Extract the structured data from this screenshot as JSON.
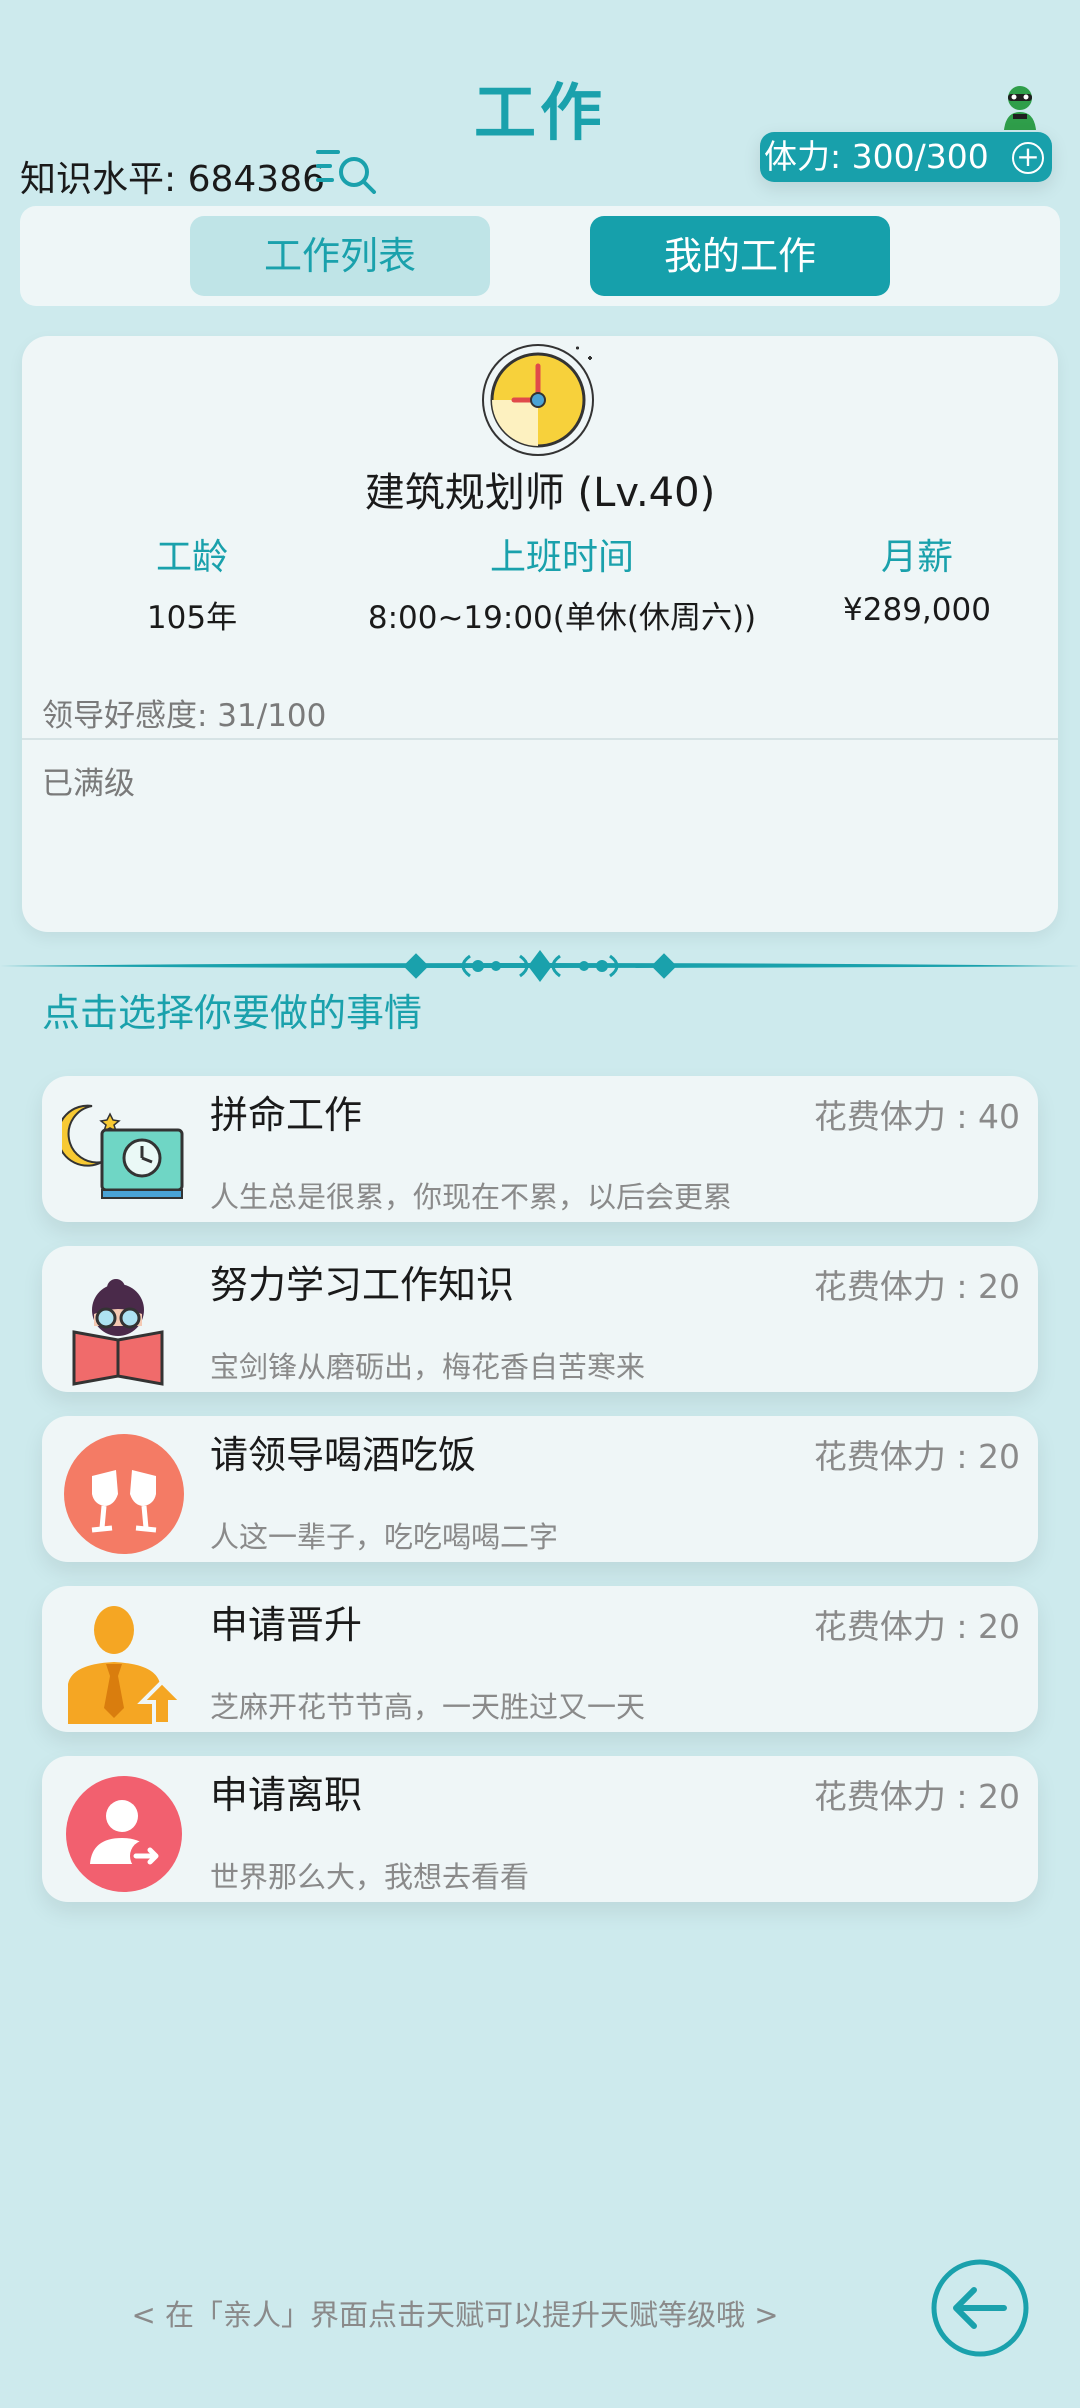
{
  "header": {
    "title": "工作",
    "knowledge": "知识水平: 684386",
    "stamina": "体力: 300/300",
    "stamina_plus": "+"
  },
  "tabs": [
    {
      "label": "工作列表"
    },
    {
      "label": "我的工作"
    }
  ],
  "job": {
    "title": "建筑规划师 (Lv.40)",
    "stats": [
      {
        "label": "工龄",
        "value": "105年"
      },
      {
        "label": "上班时间",
        "value": "8:00~19:00(单休(休周六))"
      },
      {
        "label": "月薪",
        "value": "¥289,000"
      }
    ],
    "favor": "领导好感度: 31/100",
    "status": "已满级"
  },
  "prompt": "点击选择你要做的事情",
  "actions": [
    {
      "title": "拼命工作",
      "cost": "花费体力 : 40",
      "desc": "人生总是很累，你现在不累，以后会更累",
      "icon": "night-work-icon"
    },
    {
      "title": "努力学习工作知识",
      "cost": "花费体力 : 20",
      "desc": "宝剑锋从磨砺出，梅花香自苦寒来",
      "icon": "study-icon"
    },
    {
      "title": "请领导喝酒吃饭",
      "cost": "花费体力 : 20",
      "desc": "人这一辈子，吃吃喝喝二字",
      "icon": "toast-icon"
    },
    {
      "title": "申请晋升",
      "cost": "花费体力 : 20",
      "desc": "芝麻开花节节高，一天胜过又一天",
      "icon": "promotion-icon"
    },
    {
      "title": "申请离职",
      "cost": "花费体力 : 20",
      "desc": "世界那么大，我想去看看",
      "icon": "resign-icon"
    }
  ],
  "hint": "< 在「亲人」界面点击天赋可以提升天赋等级哦 >",
  "colors": {
    "background": "#cdeaed",
    "accent": "#16a0ab",
    "card": "#eff6f7",
    "muted_text": "#8a8a8a"
  }
}
